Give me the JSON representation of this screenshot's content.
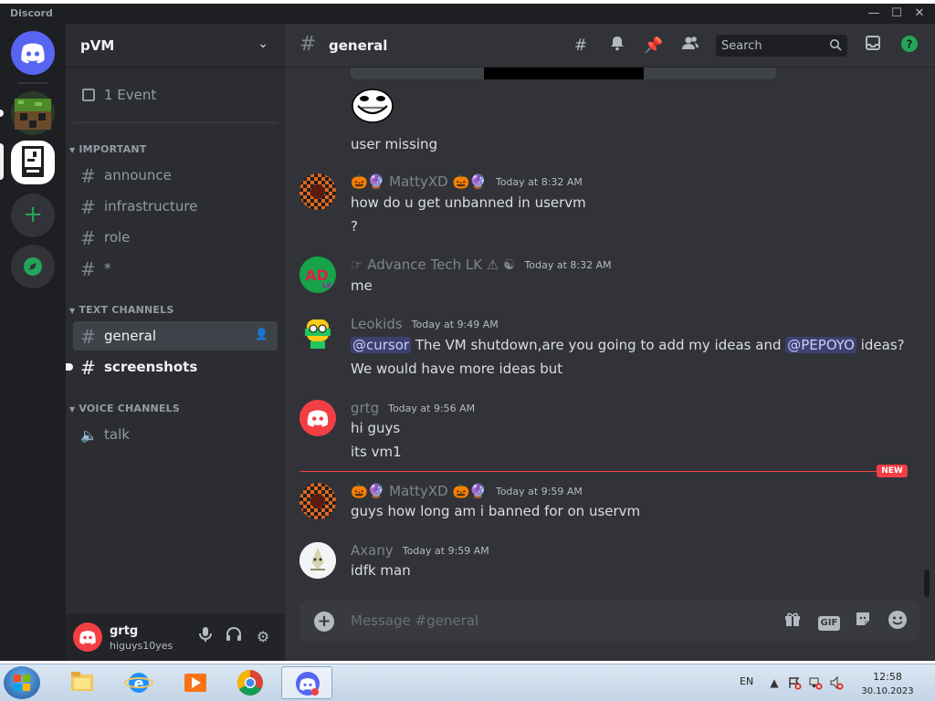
{
  "window": {
    "brand": "Discord",
    "minimize_glyph": "—",
    "maximize_glyph": "☐",
    "close_glyph": "✕"
  },
  "server": {
    "name": "pVM"
  },
  "sidebar": {
    "event_label": "1 Event",
    "categories": [
      {
        "label": "IMPORTANT",
        "channels": [
          "announce",
          "infrastructure",
          "role",
          "*"
        ]
      },
      {
        "label": "TEXT CHANNELS",
        "channels": [
          "general",
          "screenshots"
        ]
      },
      {
        "label": "VOICE CHANNELS",
        "channels": [
          "talk"
        ]
      }
    ]
  },
  "user": {
    "name": "grtg",
    "status": "higuys10yes"
  },
  "channel": {
    "name": "general",
    "search_placeholder": "Search",
    "composer_placeholder": "Message #general"
  },
  "messages": [
    {
      "lines": [
        "user missing"
      ]
    },
    {
      "author": "🎃🔮 MattyXD 🎃🔮",
      "author_color": "#80848e",
      "timestamp": "Today at 8:32 AM",
      "lines": [
        "how do u get unbanned in uservm",
        "?"
      ]
    },
    {
      "author": "☞ Advance Tech LK ⚠ ☯",
      "author_color": "#80848e",
      "timestamp": "Today at 8:32 AM",
      "lines": [
        "me"
      ]
    },
    {
      "author": "Leokids",
      "author_color": "#80848e",
      "timestamp": "Today at 9:49 AM",
      "mention1": "@cursor",
      "text_mid": " The VM shutdown,are you going to add my ideas and ",
      "mention2": "@PEPOYO",
      "text_end": " ideas?",
      "line2": "We would have more ideas but"
    },
    {
      "author": "grtg",
      "author_color": "#80848e",
      "timestamp": "Today at 9:56 AM",
      "lines": [
        "hi guys",
        "its vm1"
      ]
    },
    {
      "author": "🎃🔮 MattyXD 🎃🔮",
      "author_color": "#80848e",
      "timestamp": "Today at 9:59 AM",
      "lines": [
        "guys how long am i banned for on uservm"
      ]
    },
    {
      "author": "Axany",
      "author_color": "#80848e",
      "timestamp": "Today at 9:59 AM",
      "lines": [
        "idfk man"
      ]
    }
  ],
  "new_badge": "NEW",
  "composer": {
    "gif_label": "GIF"
  },
  "taskbar": {
    "language": "EN",
    "time": "12:58",
    "date": "30.10.2023"
  },
  "colors": {
    "accent": "#5865f2",
    "danger": "#f23f43",
    "success": "#23a559"
  }
}
